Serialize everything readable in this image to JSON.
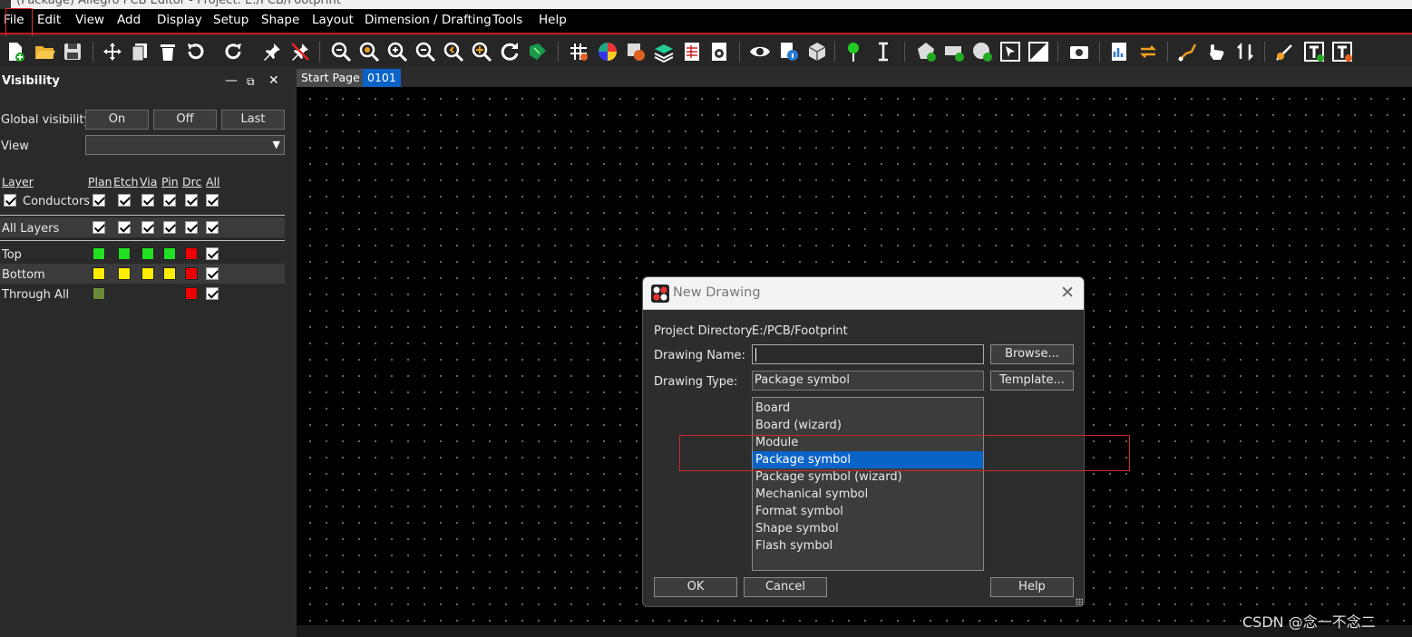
{
  "window": {
    "title": "(Package) Allegro PCB Editor - Project: E:/PCB/Footprint"
  },
  "menubar": {
    "items": [
      "File",
      "Edit",
      "View",
      "Add",
      "Display",
      "Setup",
      "Shape",
      "Layout",
      "Dimension / Drafting",
      "Tools",
      "Help"
    ]
  },
  "toolbar": {
    "icons": [
      "new-file-icon",
      "open-folder-icon",
      "save-icon",
      "move-icon",
      "copy-icon",
      "delete-icon",
      "undo-icon",
      "redo-icon",
      "pin-icon",
      "unpin-icon",
      "zoom-fit-icon",
      "zoom-world-icon",
      "zoom-in-icon",
      "zoom-out-icon",
      "zoom-previous-icon",
      "zoom-center-icon",
      "redraw-icon",
      "board-icon",
      "grid-icon",
      "color-icon",
      "shadow-icon",
      "layers-icon",
      "spreadsheet-icon",
      "settings-doc-icon",
      "visibility-eye-icon",
      "info-icon",
      "3d-box-icon",
      "add-pin-icon",
      "text-cursor-icon",
      "shape-add-icon",
      "rect-add-icon",
      "circle-add-icon",
      "select-icon",
      "fill-icon",
      "camera-icon",
      "report-icon",
      "swap-icon",
      "connect-icon",
      "hand-icon",
      "up-down-icon",
      "line-add-icon",
      "text-add-icon",
      "text-edit-icon"
    ]
  },
  "visibility": {
    "title": "Visibility",
    "global_label": "Global visibility",
    "on": "On",
    "off": "Off",
    "last": "Last",
    "view_label": "View",
    "view_value": "",
    "columns": {
      "layer": "Layer",
      "plan": "Plan",
      "etch": "Etch",
      "via": "Via",
      "pin": "Pin",
      "drc": "Drc",
      "all": "All"
    },
    "conductors": "Conductors",
    "all_layers": "All Layers",
    "layers": [
      "Top",
      "Bottom",
      "Through All"
    ],
    "colors": {
      "green": "#22e022",
      "yellow": "#ffee00",
      "red": "#ee0000",
      "olive": "#6a8a3a"
    }
  },
  "tabs": [
    "Start Page",
    "0101"
  ],
  "dialog": {
    "title": "New Drawing",
    "project_dir_label": "Project Directory:",
    "project_dir_value": "E:/PCB/Footprint",
    "drawing_name_label": "Drawing Name:",
    "drawing_name_value": "",
    "drawing_type_label": "Drawing Type:",
    "drawing_type_value": "Package symbol",
    "browse": "Browse...",
    "template": "Template...",
    "types": [
      "Board",
      "Board (wizard)",
      "Module",
      "Package symbol",
      "Package symbol (wizard)",
      "Mechanical symbol",
      "Format symbol",
      "Shape symbol",
      "Flash symbol"
    ],
    "selected_index": 3,
    "ok": "OK",
    "cancel": "Cancel",
    "help": "Help"
  },
  "watermark": "CSDN @念一不念二"
}
